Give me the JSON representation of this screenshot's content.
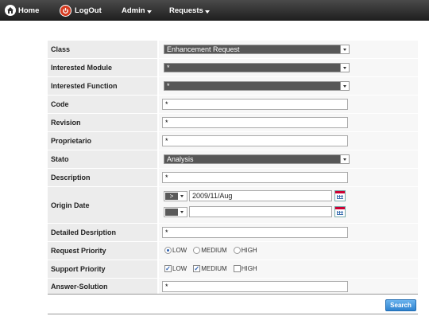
{
  "nav": {
    "home_label": "Home",
    "logout_label": "LogOut",
    "admin_label": "Admin",
    "requests_label": "Requests"
  },
  "form": {
    "class_label": "Class",
    "class_value": "Enhancement Request",
    "module_label": "Interested Module",
    "module_value": "*",
    "function_label": "Interested Function",
    "function_value": "*",
    "code_label": "Code",
    "code_value": "*",
    "revision_label": "Revision",
    "revision_value": "*",
    "owner_label": "Proprietario",
    "owner_value": "*",
    "state_label": "Stato",
    "state_value": "Analysis",
    "description_label": "Description",
    "description_value": "*",
    "origin_label": "Origin Date",
    "origin_op1": ">",
    "origin_date1": "2009/11/Aug",
    "origin_op2": "",
    "origin_date2": "",
    "detail_label": "Detailed Desription",
    "detail_value": "*",
    "req_priority_label": "Request Priority",
    "req_priority_options": [
      "LOW",
      "MEDIUM",
      "HIGH"
    ],
    "sup_priority_label": "Support Priority",
    "sup_priority_options": [
      "LOW",
      "MEDIUM",
      "HIGH"
    ],
    "answer_label": "Answer-Solution",
    "answer_value": "*"
  },
  "search_label": "Search"
}
